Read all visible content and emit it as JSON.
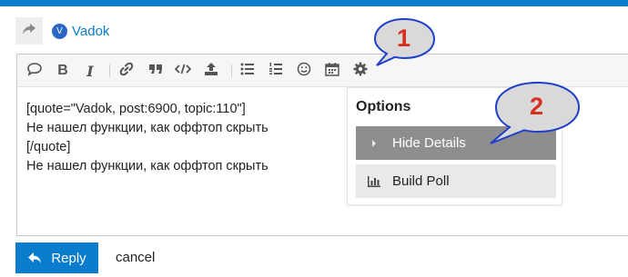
{
  "colors": {
    "accent": "#0a7ccd",
    "active_option_bg": "#8e8e8e",
    "option_bg": "#e9e9e9",
    "callout_number": "#d63020",
    "callout_fill": "#d9d9d9",
    "callout_border": "#1f3fc9"
  },
  "reply_to": {
    "icon": "share-arrow-icon",
    "avatar_letter": "V",
    "username": "Vadok"
  },
  "toolbar": {
    "icons": [
      "speech-bubble-icon",
      "bold-icon",
      "italic-icon",
      "link-icon",
      "quote-icon",
      "code-icon",
      "upload-icon",
      "bullet-list-icon",
      "numbered-list-icon",
      "emoji-icon",
      "calendar-icon",
      "gear-icon"
    ],
    "bold_label": "B",
    "italic_label": "I"
  },
  "editor": {
    "lines": [
      "[quote=\"Vadok, post:6900, topic:110\"]",
      "Не нашел функции, как оффтоп скрыть",
      "[/quote]",
      "Не нашел функции, как оффтоп скрыть"
    ]
  },
  "options": {
    "title": "Options",
    "items": [
      {
        "label": "Hide Details",
        "icon": "caret-right-icon",
        "active": true
      },
      {
        "label": "Build Poll",
        "icon": "bar-chart-icon",
        "active": false
      }
    ]
  },
  "actions": {
    "reply_label": "Reply",
    "cancel_label": "cancel"
  },
  "callouts": [
    {
      "number": "1"
    },
    {
      "number": "2"
    }
  ]
}
